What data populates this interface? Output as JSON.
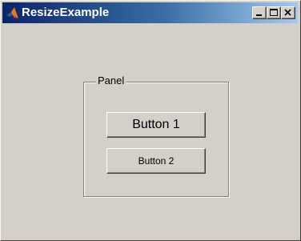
{
  "window": {
    "title": "ResizeExample",
    "icon": "matlab-membrane-icon",
    "controls": [
      "minimize-icon",
      "maximize-icon",
      "close-icon"
    ]
  },
  "panel": {
    "title": "Panel"
  },
  "buttons": {
    "button1_label": "Button 1",
    "button2_label": "Button 2"
  },
  "colors": {
    "titlebar_start": "#0a246a",
    "titlebar_end": "#a6caf0",
    "background": "#d4d0c8"
  }
}
